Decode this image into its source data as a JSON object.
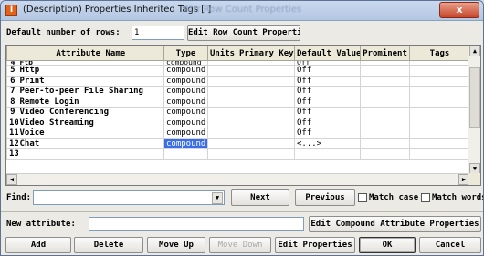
{
  "window": {
    "icon_letter": "I",
    "title": "(Description) Properties Inherited Tags [ ]",
    "ghost_title": "Attr  Row Count  Properties",
    "close_label": "x"
  },
  "top": {
    "rows_label": "Default number of rows:",
    "rows_value": "1",
    "edit_row_count_label": "Edit Row Count Properties"
  },
  "grid": {
    "columns": [
      "Attribute Name",
      "Type",
      "Units",
      "Primary Key",
      "Default Value",
      "Prominent",
      "Tags"
    ],
    "partial_row": {
      "num": "4",
      "name": "Ftp",
      "type": "compound",
      "default": "Off"
    },
    "rows": [
      {
        "num": "5",
        "name": "Http",
        "type": "compound",
        "default": "Off"
      },
      {
        "num": "6",
        "name": "Print",
        "type": "compound",
        "default": "Off"
      },
      {
        "num": "7",
        "name": "Peer-to-peer File Sharing",
        "type": "compound",
        "default": "Off"
      },
      {
        "num": "8",
        "name": "Remote Login",
        "type": "compound",
        "default": "Off"
      },
      {
        "num": "9",
        "name": "Video Conferencing",
        "type": "compound",
        "default": "Off"
      },
      {
        "num": "10",
        "name": "Video Streaming",
        "type": "compound",
        "default": "Off"
      },
      {
        "num": "11",
        "name": "Voice",
        "type": "compound",
        "default": "Off"
      },
      {
        "num": "12",
        "name": "Chat",
        "type": "compound",
        "default": "<...>",
        "selected": true
      },
      {
        "num": "13",
        "name": "",
        "type": "",
        "default": ""
      }
    ]
  },
  "find": {
    "label": "Find:",
    "value": "",
    "next_label": "Next",
    "previous_label": "Previous",
    "match_case_label": "Match case",
    "match_words_label": "Match words"
  },
  "new_attr": {
    "label": "New attribute:",
    "value": "",
    "edit_compound_label": "Edit Compound Attribute Properties"
  },
  "bottom_buttons": {
    "add": "Add",
    "delete": "Delete",
    "move_up": "Move Up",
    "move_down": "Move Down",
    "edit_properties": "Edit Properties",
    "ok": "OK",
    "cancel": "Cancel"
  },
  "colors": {
    "selection": "#3a6ee8",
    "title_bar": "#b4c7e2",
    "close": "#c7462b"
  }
}
